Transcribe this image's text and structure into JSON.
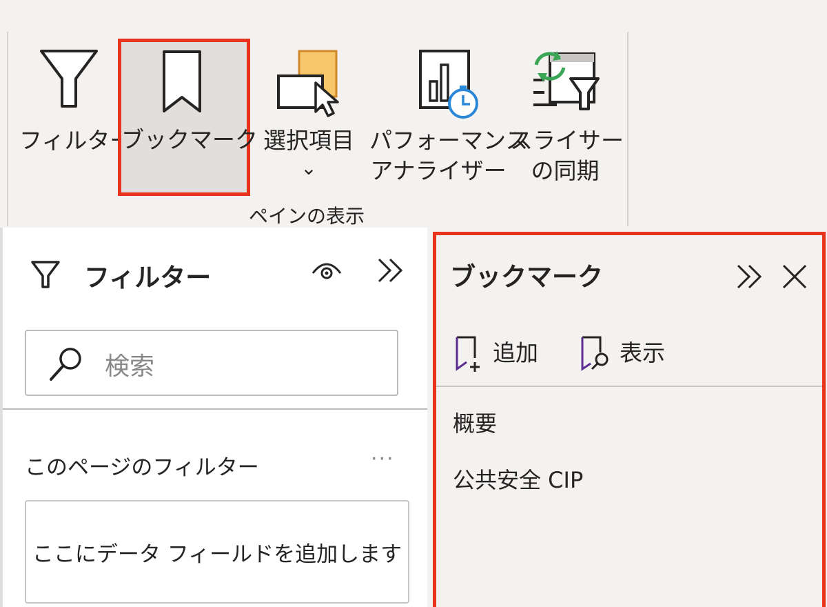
{
  "ribbon": {
    "buttons": {
      "filter": "フィルター",
      "bookmark": "ブックマーク",
      "selection": "選択項目",
      "performance_line1": "パフォーマンス",
      "performance_line2": "アナライザー",
      "sync_line1": "スライサー",
      "sync_line2": "の同期"
    },
    "group_label": "ペインの表示",
    "selection_chevron": "⌄"
  },
  "filter_pane": {
    "title": "フィルター",
    "search_placeholder": "検索",
    "section_title": "このページのフィルター",
    "more": "···",
    "drop_zone_text": "ここにデータ フィールドを追加します"
  },
  "bookmark_pane": {
    "title": "ブックマーク",
    "add_label": "追加",
    "view_label": "表示",
    "items": [
      "概要",
      "公共安全 CIP"
    ]
  },
  "colors": {
    "highlight": "#e8341c",
    "accent_orange": "#f7c66a",
    "accent_green": "#3aa655",
    "accent_blue": "#2b88d8",
    "accent_purple": "#5c2d91"
  },
  "icons": {
    "filter": "funnel-icon",
    "bookmark": "bookmark-icon",
    "selection": "selection-pane-icon",
    "performance": "performance-analyzer-icon",
    "sync": "sync-slicers-icon",
    "visibility": "eye-icon",
    "collapse": "double-chevron-right-icon",
    "close": "close-icon",
    "search": "search-icon",
    "add_bookmark": "bookmark-add-icon",
    "view_bookmark": "bookmark-view-icon"
  }
}
